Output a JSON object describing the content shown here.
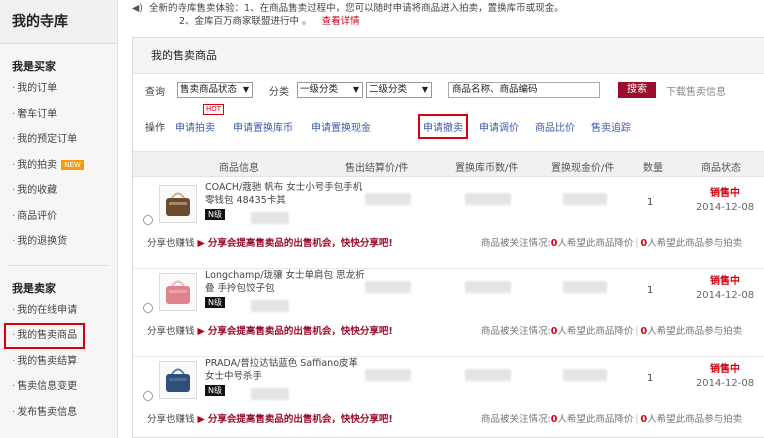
{
  "sidebar": {
    "title": "我的寺库",
    "buyer_title": "我是买家",
    "buyer_items": [
      {
        "label": "我的订单"
      },
      {
        "label": "奢车订单"
      },
      {
        "label": "我的预定订单"
      },
      {
        "label": "我的拍卖",
        "badge": "NEW"
      },
      {
        "label": "我的收藏"
      },
      {
        "label": "商品评价"
      },
      {
        "label": "我的退换货"
      }
    ],
    "seller_title": "我是卖家",
    "seller_items": [
      {
        "label": "我的在线申请"
      },
      {
        "label": "我的售卖商品",
        "active": true
      },
      {
        "label": "我的售卖结算"
      },
      {
        "label": "售卖信息变更"
      },
      {
        "label": "发布售卖信息"
      }
    ]
  },
  "notice": {
    "line1": "全新的寺库售卖体验：1、在商品售卖过程中，您可以随时申请将商品进入拍卖，置换库币或现金。",
    "line2": "2、金库百万商家联盟进行中 。",
    "link": "查看详情"
  },
  "panel": {
    "title": "我的售卖商品",
    "filter": {
      "label": "查询",
      "status_select": "售卖商品状态",
      "category_label": "分类",
      "cat1_select": "一级分类",
      "cat2_select": "二级分类",
      "search_value": "商品名称、商品编码",
      "search_btn": "搜索",
      "download": "下载售卖信息"
    },
    "ops": {
      "label": "操作",
      "hot": "HOT",
      "items": [
        "申请拍卖",
        "申请置换库币",
        "申请置换现金",
        "申请撤卖",
        "申请调价",
        "商品比价",
        "售卖追踪"
      ]
    },
    "columns": [
      "商品信息",
      "售出结算价/件",
      "置换库币数/件",
      "置换现金价/件",
      "数量",
      "商品状态"
    ],
    "rows": [
      {
        "name": "COACH/蔻驰 帆布 女士小号手包手机零钱包 48435卡其",
        "tag": "N级",
        "qty": "1",
        "status": "销售中",
        "date": "2014-12-08",
        "thumb_color": "#6b4a2e",
        "thumb_accent": "#c9b393"
      },
      {
        "name": "Longchamp/珑骧 女士单肩包 思龙折叠 手拎包饺子包",
        "tag": "N级",
        "qty": "1",
        "status": "销售中",
        "date": "2014-12-08",
        "thumb_color": "#e2828f",
        "thumb_accent": "#f3b7bf"
      },
      {
        "name": "PRADA/普拉达钴蓝色 Saffiano皮革女士中号杀手",
        "tag": "N级",
        "qty": "1",
        "status": "销售中",
        "date": "2014-12-08",
        "thumb_color": "#2d4f78",
        "thumb_accent": "#5b7fa9"
      }
    ],
    "share": {
      "label": "分享也赚钱",
      "arrow": "▶",
      "text": "分享会提高售卖品的出售机会，快快分享吧!"
    },
    "concern": {
      "label": "商品被关注情况:",
      "n1": "0",
      "t1": "人希望此商品降价",
      "sep": "|",
      "n2": "0",
      "t2": "人希望此商品参与拍卖"
    }
  }
}
